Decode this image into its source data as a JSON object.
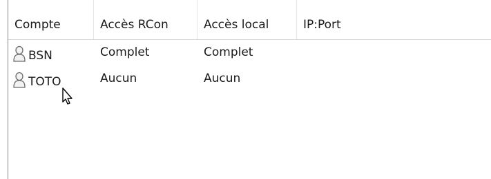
{
  "columns": {
    "account": "Compte",
    "rcon_access": "Accès RCon",
    "local_access": "Accès local",
    "ip_port": "IP:Port"
  },
  "rows": [
    {
      "account": "BSN",
      "rcon_access": "Complet",
      "local_access": "Complet",
      "ip_port": ""
    },
    {
      "account": "TOTO",
      "rcon_access": "Aucun",
      "local_access": "Aucun",
      "ip_port": ""
    }
  ],
  "icons": {
    "user": "user-icon",
    "cursor": "mouse-pointer-icon"
  },
  "colors": {
    "border": "#828790",
    "text": "#1a1a1a",
    "header_separator": "#e5e5e5"
  }
}
